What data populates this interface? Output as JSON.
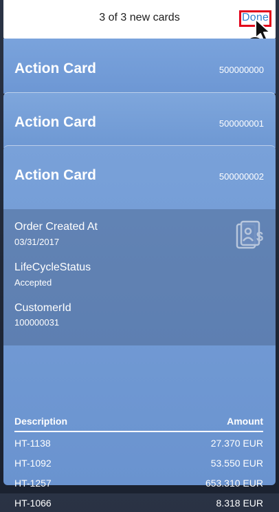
{
  "header": {
    "title": "3 of 3 new cards",
    "done_label": "Done"
  },
  "annotation": {
    "step": "1"
  },
  "cards": [
    {
      "title": "Action Card",
      "number": "500000000"
    },
    {
      "title": "Action Card",
      "number": "500000001"
    },
    {
      "title": "Action Card",
      "number": "500000002"
    }
  ],
  "details": {
    "order_created_label": "Order Created At",
    "order_created_value": "03/31/2017",
    "lifecycle_label": "LifeCycleStatus",
    "lifecycle_value": "Accepted",
    "customer_label": "CustomerId",
    "customer_value": "100000031",
    "icon": "document-dollar-icon"
  },
  "table": {
    "headers": {
      "description": "Description",
      "amount": "Amount"
    },
    "rows": [
      {
        "description": "HT-1138",
        "amount": "27.370 EUR"
      },
      {
        "description": "HT-1092",
        "amount": "53.550 EUR"
      },
      {
        "description": "HT-1257",
        "amount": "653.310 EUR"
      },
      {
        "description": "HT-1066",
        "amount": "8.318 EUR"
      }
    ]
  },
  "colors": {
    "card": "#739cd6",
    "accent": "#2f7fd0",
    "highlight": "#e2001a",
    "badge": "#f7d21c"
  }
}
